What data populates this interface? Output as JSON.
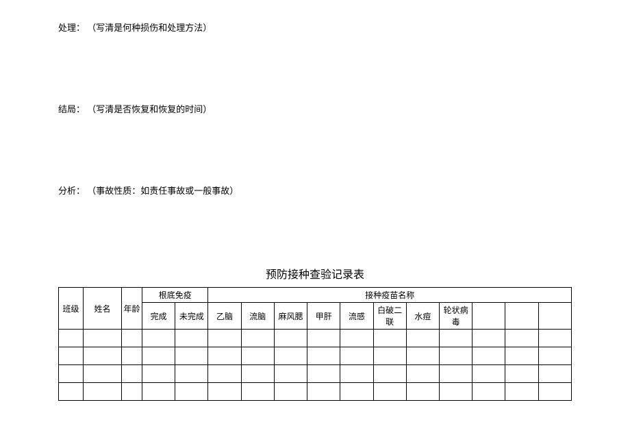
{
  "sections": {
    "treatment": {
      "label": "处理：",
      "hint": "（写清是何种损伤和处理方法）"
    },
    "outcome": {
      "label": "结局：",
      "hint": "（写清是否恢复和恢复的时间）"
    },
    "analysis": {
      "label": "分析：",
      "hint": "（事故性质：如责任事故或一般事故）"
    }
  },
  "table": {
    "title": "预防接种查验记录表",
    "headers": {
      "class": "班级",
      "name": "姓名",
      "age": "年龄",
      "base_immune": "根底免疫",
      "done": "完成",
      "undone": "未完成",
      "vaccine_name": "接种疫苗名称",
      "vaccines": [
        "乙脑",
        "流脑",
        "麻风腮",
        "甲肝",
        "流感",
        "白破二联",
        "水痘",
        "轮状病毒"
      ]
    }
  }
}
